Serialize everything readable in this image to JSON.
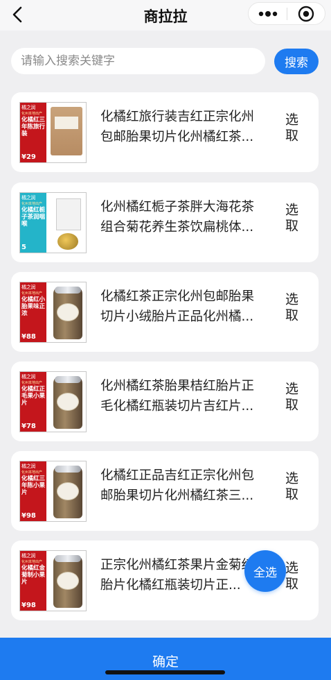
{
  "header": {
    "title": "商拉拉",
    "back_icon": "chevron-left-icon",
    "more_icon": "more-dots-icon",
    "close_icon": "target-close-icon"
  },
  "search": {
    "placeholder": "请输入搜索关键字",
    "value": "",
    "button_label": "搜索"
  },
  "products": [
    {
      "title": "化橘红旅行装吉红正宗化州包邮胎果切片化州橘红茶...",
      "select_label": "选取",
      "thumb": {
        "brand": "橘之润",
        "subtitle": "化州本地出产",
        "name": "化橘红三年陈旅行装",
        "price": "¥29",
        "style": "bag",
        "band_color": "#c4161c"
      }
    },
    {
      "title": "化州橘红栀子茶胖大海花茶组合菊花养生茶饮扁桃体...",
      "select_label": "选取",
      "thumb": {
        "brand": "橘之润",
        "subtitle": "化州本地出产",
        "name": "化橘红栀子茶润咽喉",
        "price": "5",
        "style": "pouch",
        "band_color": "#24b4c9"
      }
    },
    {
      "title": "化橘红茶正宗化州包邮胎果切片小绒胎片正品化州橘...",
      "select_label": "选取",
      "thumb": {
        "brand": "橘之润",
        "subtitle": "化州本地出产",
        "name": "化橘红小胎果味正浓",
        "price": "¥88",
        "style": "jar",
        "band_color": "#c4161c"
      }
    },
    {
      "title": "化州橘红茶胎果桔红胎片正毛化橘红瓶装切片吉红片...",
      "select_label": "选取",
      "thumb": {
        "brand": "橘之润",
        "subtitle": "化州本地出产",
        "name": "化橘红正毛果小果片",
        "price": "¥78",
        "style": "jar",
        "band_color": "#c4161c"
      }
    },
    {
      "title": "化橘红正品吉红正宗化州包邮胎果切片化州橘红茶三...",
      "select_label": "选取",
      "thumb": {
        "brand": "橘之润",
        "subtitle": "化州本地出产",
        "name": "化橘红三年陈小果片",
        "price": "¥98",
        "style": "jar",
        "band_color": "#c4161c"
      }
    },
    {
      "title": "正宗化州橘红茶果片金菊红胎片化橘红瓶装切片正...",
      "select_label": "选取",
      "thumb": {
        "brand": "橘之润",
        "subtitle": "化州本地出产",
        "name": "化橘红金菊制小果片",
        "price": "¥98",
        "style": "jar",
        "band_color": "#c4161c"
      }
    }
  ],
  "floating": {
    "select_all_label": "全选"
  },
  "footer": {
    "confirm_label": "确定"
  },
  "colors": {
    "accent": "#1e7bf0",
    "background": "#efeff1",
    "card": "#ffffff"
  }
}
